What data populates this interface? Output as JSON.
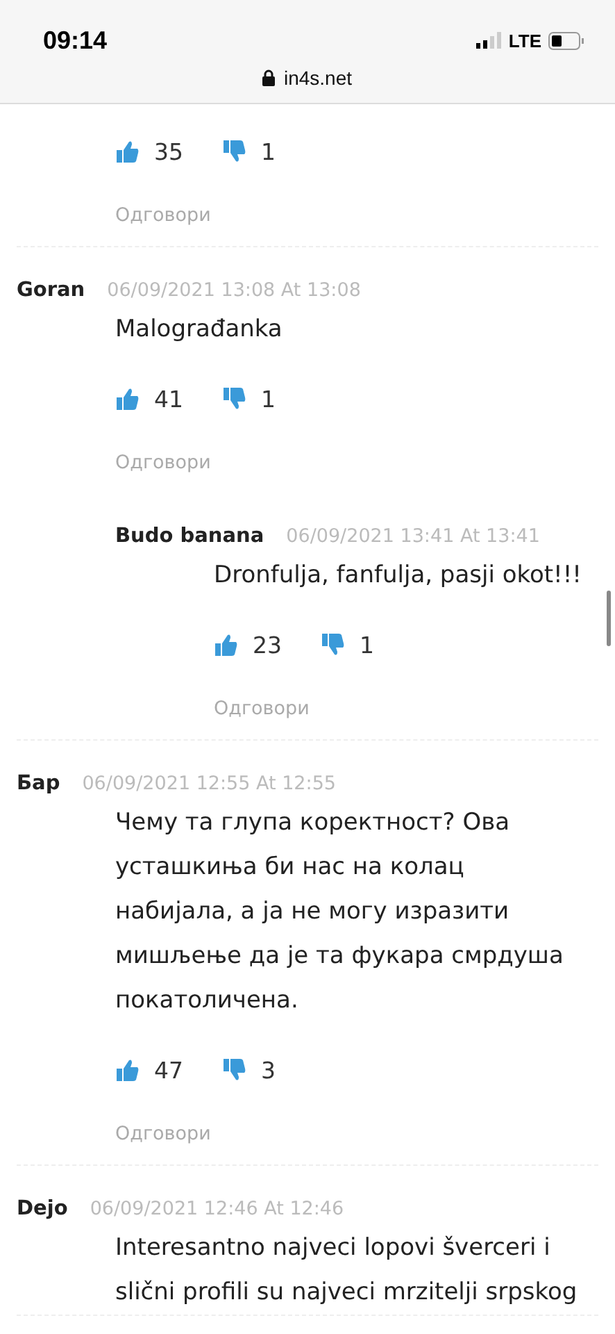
{
  "status_bar": {
    "time": "09:14",
    "network": "LTE"
  },
  "address_bar": {
    "url": "in4s.net"
  },
  "comments": [
    {
      "likes": "35",
      "dislikes": "1",
      "reply": "Одговори"
    },
    {
      "author": "Goran",
      "date": "06/09/2021 13:08 At 13:08",
      "body": "Malograđanka",
      "likes": "41",
      "dislikes": "1",
      "reply": "Одговори",
      "children": [
        {
          "author": "Budo banana",
          "date": "06/09/2021 13:41 At 13:41",
          "body": "Dronfulja, fanfulja, pasji okot!!!",
          "likes": "23",
          "dislikes": "1",
          "reply": "Одговори"
        }
      ]
    },
    {
      "author": "Бар",
      "date": "06/09/2021 12:55 At 12:55",
      "body": "Чему та глупа коректност? Ова усташкиња би нас на колац набијала, а ја не могу изразити мишљење да је та фукара смрдуша покатоличена.",
      "likes": "47",
      "dislikes": "3",
      "reply": "Одговори"
    },
    {
      "author": "Dejo",
      "date": "06/09/2021 12:46 At 12:46",
      "body": "Interesantno najveci lopovi šverceri i slični profili su najveci mrzitelji srpskog"
    }
  ]
}
